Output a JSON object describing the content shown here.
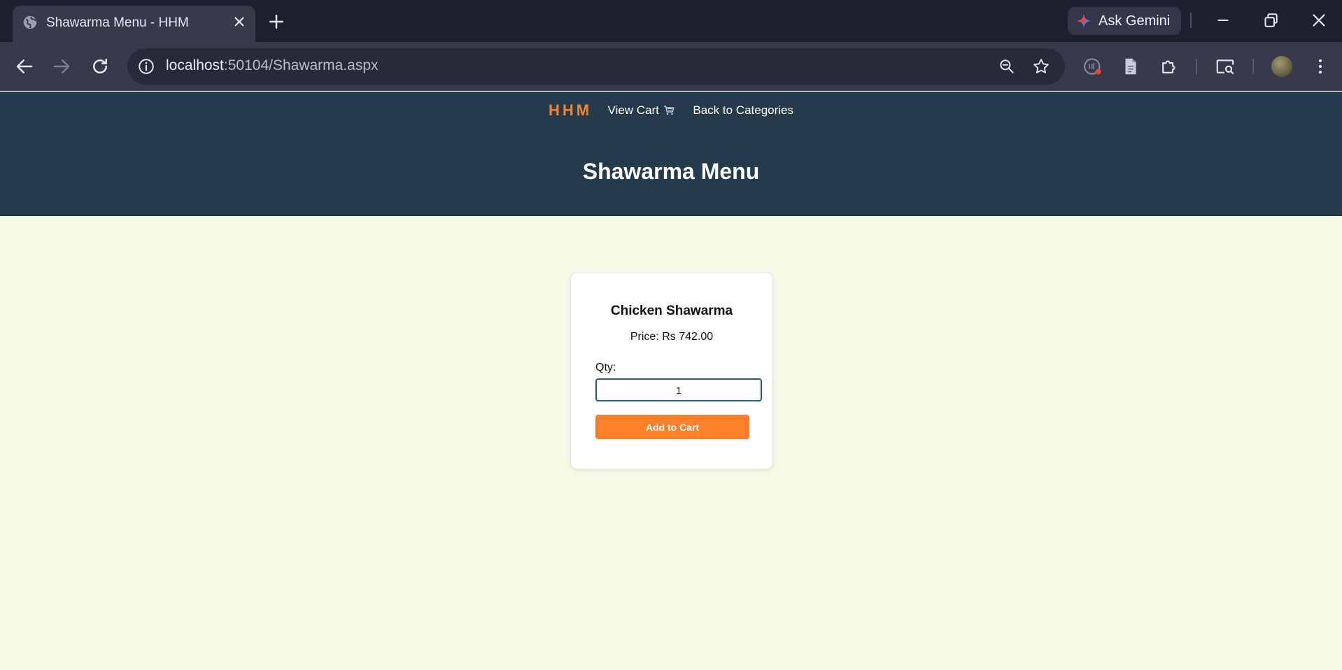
{
  "browser": {
    "tab_title": "Shawarma Menu - HHM",
    "ask_gemini_label": "Ask Gemini",
    "url_host": "localhost",
    "url_path": ":50104/Shawarma.aspx"
  },
  "site": {
    "brand": "HHM",
    "nav": {
      "view_cart": "View Cart",
      "back_to_categories": "Back to Categories"
    },
    "page_title": "Shawarma Menu"
  },
  "product": {
    "name": "Chicken Shawarma",
    "price_text": "Price: Rs 742.00",
    "qty_label": "Qty:",
    "qty_value": "1",
    "add_button": "Add to Cart"
  },
  "colors": {
    "accent_orange": "#ff7f2a",
    "header_bg": "#233b4a",
    "page_bg": "#f5fae7"
  },
  "icons": {
    "favicon": "globe-icon",
    "cart": "cart-icon"
  }
}
